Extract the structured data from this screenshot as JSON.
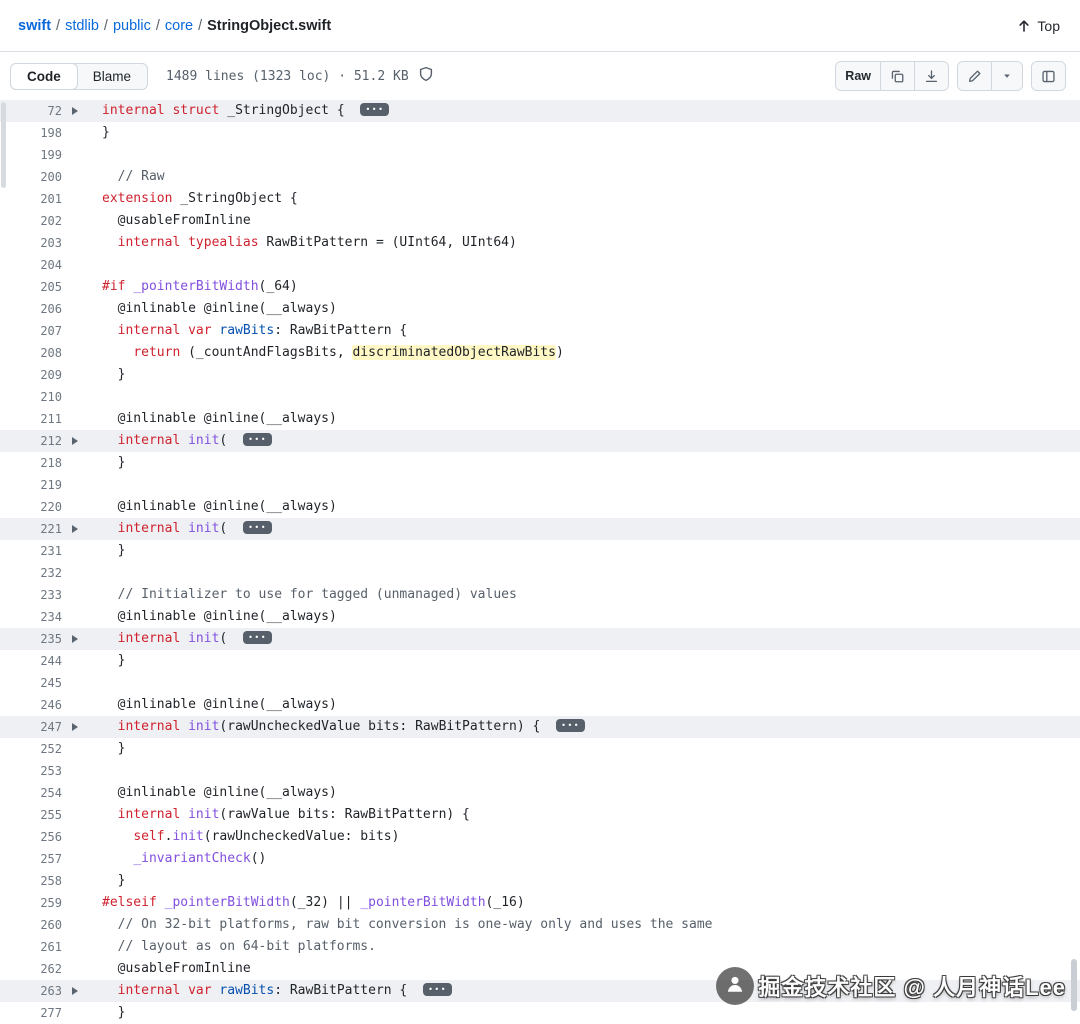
{
  "breadcrumb": {
    "segments": [
      "swift",
      "stdlib",
      "public",
      "core"
    ],
    "file": "StringObject.swift",
    "separator": "/"
  },
  "top_link": {
    "label": "Top"
  },
  "toolbar": {
    "code_tab": "Code",
    "blame_tab": "Blame",
    "meta": "1489 lines (1323 loc) · 51.2 KB",
    "raw_button": "Raw"
  },
  "icons": {
    "up_arrow": "arrow-up",
    "shield": "shield-outline",
    "copy": "overlapping-squares",
    "download": "arrow-into-tray",
    "edit": "pencil",
    "caret": "triangle-down",
    "symbols_panel": "square-outline",
    "fold": "triangle-right-chevron",
    "collapsed": "horizontal-ellipsis-badge"
  },
  "colors": {
    "link": "#0969da",
    "keyword": "#cf222e",
    "entity": "#8250df",
    "constant": "#0550ae",
    "comment": "#57606a",
    "plain": "#1f2328",
    "highlight": "#fff8c5",
    "fold_band": "#eef0f3",
    "border": "#d0d7de"
  },
  "code": {
    "lines": [
      {
        "num": 72,
        "fold": true,
        "band": true,
        "badge": true,
        "tokens": [
          [
            "k",
            "internal"
          ],
          [
            "p",
            " "
          ],
          [
            "k",
            "struct"
          ],
          [
            "p",
            " _StringObject { "
          ]
        ]
      },
      {
        "num": 198,
        "tokens": [
          [
            "p",
            "}"
          ]
        ]
      },
      {
        "num": 199,
        "tokens": []
      },
      {
        "num": 200,
        "tokens": [
          [
            "p",
            "  "
          ],
          [
            "cm",
            "// Raw"
          ]
        ]
      },
      {
        "num": 201,
        "tokens": [
          [
            "k",
            "extension"
          ],
          [
            "p",
            " _StringObject {"
          ]
        ]
      },
      {
        "num": 202,
        "tokens": [
          [
            "p",
            "  @usableFromInline"
          ]
        ]
      },
      {
        "num": 203,
        "tokens": [
          [
            "p",
            "  "
          ],
          [
            "k",
            "internal typealias"
          ],
          [
            "p",
            " RawBitPattern = (UInt64, UInt64)"
          ]
        ]
      },
      {
        "num": 204,
        "tokens": []
      },
      {
        "num": 205,
        "tokens": [
          [
            "k",
            "#if"
          ],
          [
            "p",
            " "
          ],
          [
            "e",
            "_pointerBitWidth"
          ],
          [
            "p",
            "(_64)"
          ]
        ]
      },
      {
        "num": 206,
        "tokens": [
          [
            "p",
            "  @inlinable @inline(__always)"
          ]
        ]
      },
      {
        "num": 207,
        "tokens": [
          [
            "p",
            "  "
          ],
          [
            "k",
            "internal var"
          ],
          [
            "p",
            " "
          ],
          [
            "c",
            "rawBits"
          ],
          [
            "p",
            ": RawBitPattern {"
          ]
        ]
      },
      {
        "num": 208,
        "tokens": [
          [
            "p",
            "    "
          ],
          [
            "k",
            "return"
          ],
          [
            "p",
            " (_countAndFlagsBits, "
          ],
          [
            "hl",
            "discriminatedObjectRawBits"
          ],
          [
            "p",
            ")"
          ]
        ]
      },
      {
        "num": 209,
        "tokens": [
          [
            "p",
            "  }"
          ]
        ]
      },
      {
        "num": 210,
        "tokens": []
      },
      {
        "num": 211,
        "tokens": [
          [
            "p",
            "  @inlinable @inline(__always)"
          ]
        ]
      },
      {
        "num": 212,
        "fold": true,
        "band": true,
        "badge": true,
        "tokens": [
          [
            "p",
            "  "
          ],
          [
            "k",
            "internal"
          ],
          [
            "p",
            " "
          ],
          [
            "e",
            "init"
          ],
          [
            "p",
            "( "
          ]
        ]
      },
      {
        "num": 218,
        "tokens": [
          [
            "p",
            "  }"
          ]
        ]
      },
      {
        "num": 219,
        "tokens": []
      },
      {
        "num": 220,
        "tokens": [
          [
            "p",
            "  @inlinable @inline(__always)"
          ]
        ]
      },
      {
        "num": 221,
        "fold": true,
        "band": true,
        "badge": true,
        "tokens": [
          [
            "p",
            "  "
          ],
          [
            "k",
            "internal"
          ],
          [
            "p",
            " "
          ],
          [
            "e",
            "init"
          ],
          [
            "p",
            "( "
          ]
        ]
      },
      {
        "num": 231,
        "tokens": [
          [
            "p",
            "  }"
          ]
        ]
      },
      {
        "num": 232,
        "tokens": []
      },
      {
        "num": 233,
        "tokens": [
          [
            "p",
            "  "
          ],
          [
            "cm",
            "// Initializer to use for tagged (unmanaged) values"
          ]
        ]
      },
      {
        "num": 234,
        "tokens": [
          [
            "p",
            "  @inlinable @inline(__always)"
          ]
        ]
      },
      {
        "num": 235,
        "fold": true,
        "band": true,
        "badge": true,
        "tokens": [
          [
            "p",
            "  "
          ],
          [
            "k",
            "internal"
          ],
          [
            "p",
            " "
          ],
          [
            "e",
            "init"
          ],
          [
            "p",
            "( "
          ]
        ]
      },
      {
        "num": 244,
        "tokens": [
          [
            "p",
            "  }"
          ]
        ]
      },
      {
        "num": 245,
        "tokens": []
      },
      {
        "num": 246,
        "tokens": [
          [
            "p",
            "  @inlinable @inline(__always)"
          ]
        ]
      },
      {
        "num": 247,
        "fold": true,
        "band": true,
        "badge": true,
        "tokens": [
          [
            "p",
            "  "
          ],
          [
            "k",
            "internal"
          ],
          [
            "p",
            " "
          ],
          [
            "e",
            "init"
          ],
          [
            "p",
            "(rawUncheckedValue bits: RawBitPattern) { "
          ]
        ]
      },
      {
        "num": 252,
        "tokens": [
          [
            "p",
            "  }"
          ]
        ]
      },
      {
        "num": 253,
        "tokens": []
      },
      {
        "num": 254,
        "tokens": [
          [
            "p",
            "  @inlinable @inline(__always)"
          ]
        ]
      },
      {
        "num": 255,
        "tokens": [
          [
            "p",
            "  "
          ],
          [
            "k",
            "internal"
          ],
          [
            "p",
            " "
          ],
          [
            "e",
            "init"
          ],
          [
            "p",
            "(rawValue bits: RawBitPattern) {"
          ]
        ]
      },
      {
        "num": 256,
        "tokens": [
          [
            "p",
            "    "
          ],
          [
            "k",
            "self"
          ],
          [
            "p",
            "."
          ],
          [
            "e",
            "init"
          ],
          [
            "p",
            "(rawUncheckedValue: bits)"
          ]
        ]
      },
      {
        "num": 257,
        "tokens": [
          [
            "p",
            "    "
          ],
          [
            "e",
            "_invariantCheck"
          ],
          [
            "p",
            "()"
          ]
        ]
      },
      {
        "num": 258,
        "tokens": [
          [
            "p",
            "  }"
          ]
        ]
      },
      {
        "num": 259,
        "tokens": [
          [
            "k",
            "#elseif"
          ],
          [
            "p",
            " "
          ],
          [
            "e",
            "_pointerBitWidth"
          ],
          [
            "p",
            "(_32) || "
          ],
          [
            "e",
            "_pointerBitWidth"
          ],
          [
            "p",
            "(_16)"
          ]
        ]
      },
      {
        "num": 260,
        "tokens": [
          [
            "p",
            "  "
          ],
          [
            "cm",
            "// On 32-bit platforms, raw bit conversion is one-way only and uses the same"
          ]
        ]
      },
      {
        "num": 261,
        "tokens": [
          [
            "p",
            "  "
          ],
          [
            "cm",
            "// layout as on 64-bit platforms."
          ]
        ]
      },
      {
        "num": 262,
        "tokens": [
          [
            "p",
            "  @usableFromInline"
          ]
        ]
      },
      {
        "num": 263,
        "fold": true,
        "band": true,
        "badge": true,
        "tokens": [
          [
            "p",
            "  "
          ],
          [
            "k",
            "internal var"
          ],
          [
            "p",
            " "
          ],
          [
            "c",
            "rawBits"
          ],
          [
            "p",
            ": RawBitPattern { "
          ]
        ]
      },
      {
        "num": 277,
        "tokens": [
          [
            "p",
            "  }"
          ]
        ]
      }
    ]
  },
  "watermark": {
    "text": "掘金技术社区 @ 人月神话Lee"
  }
}
